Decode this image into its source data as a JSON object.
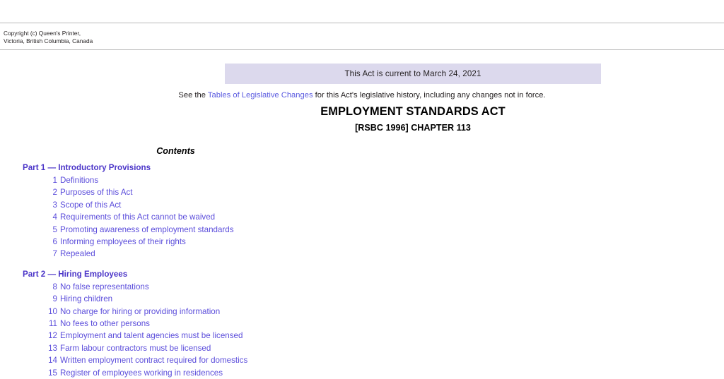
{
  "header": {
    "copyright": "Copyright (c) Queen's Printer,\nVictoria, British Columbia, Canada"
  },
  "banner": {
    "currency_text": "This Act is current to March 24, 2021",
    "background_color": "#dcd9ed"
  },
  "legislative_changes": {
    "prefix": "See the ",
    "link_text": "Tables of Legislative Changes",
    "suffix": " for this Act's legislative history, including any changes not in force.",
    "link_color": "#5b5be0"
  },
  "document": {
    "title": "EMPLOYMENT STANDARDS ACT",
    "chapter": "[RSBC 1996] CHAPTER 113",
    "contents_heading": "Contents"
  },
  "toc": {
    "link_color": "#5b4ddb",
    "heading_color": "#4b35c8",
    "parts": [
      {
        "heading": "Part 1 — Introductory Provisions",
        "entries": [
          {
            "num": "1",
            "label": "Definitions"
          },
          {
            "num": "2",
            "label": "Purposes of this Act"
          },
          {
            "num": "3",
            "label": "Scope of this Act"
          },
          {
            "num": "4",
            "label": "Requirements of this Act cannot be waived"
          },
          {
            "num": "5",
            "label": "Promoting awareness of employment standards"
          },
          {
            "num": "6",
            "label": "Informing employees of their rights"
          },
          {
            "num": "7",
            "label": "Repealed"
          }
        ]
      },
      {
        "heading": "Part 2 — Hiring Employees",
        "entries": [
          {
            "num": "8",
            "label": "No false representations"
          },
          {
            "num": "9",
            "label": "Hiring children"
          },
          {
            "num": "10",
            "label": "No charge for hiring or providing information"
          },
          {
            "num": "11",
            "label": "No fees to other persons"
          },
          {
            "num": "12",
            "label": "Employment and talent agencies must be licensed"
          },
          {
            "num": "13",
            "label": "Farm labour contractors must be licensed"
          },
          {
            "num": "14",
            "label": "Written employment contract required for domestics"
          },
          {
            "num": "15",
            "label": "Register of employees working in residences"
          }
        ]
      }
    ]
  }
}
